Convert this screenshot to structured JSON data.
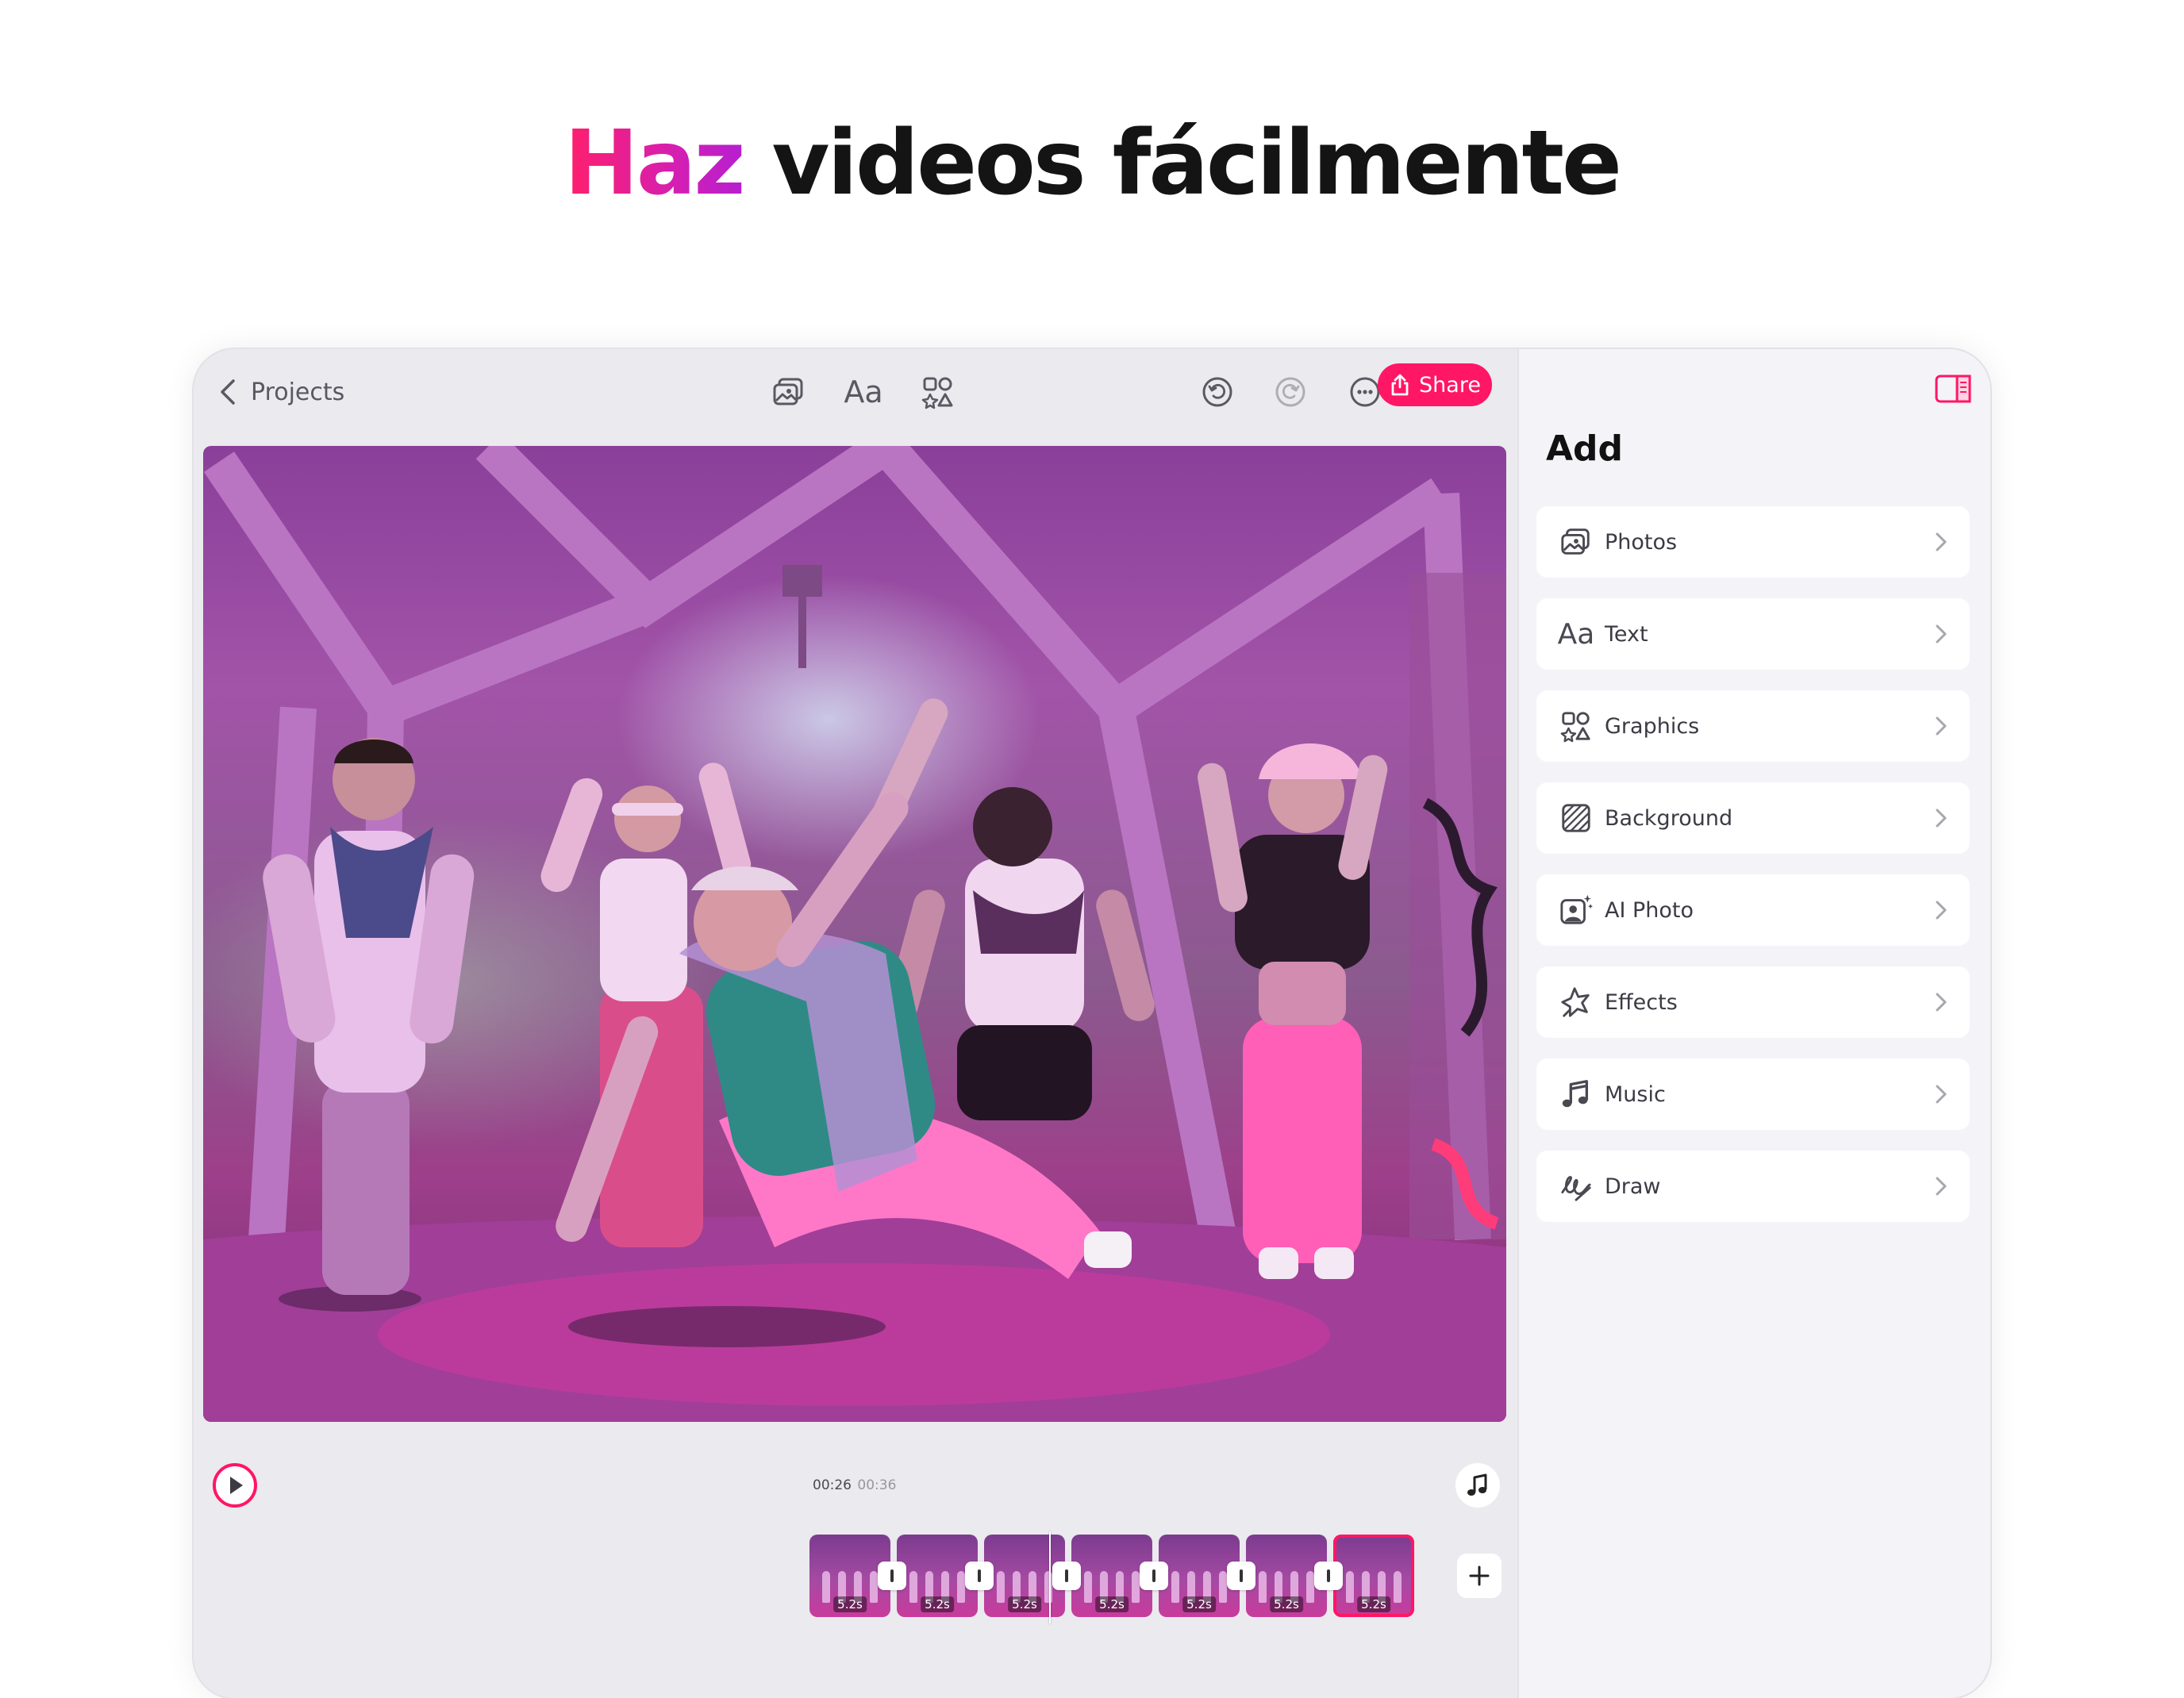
{
  "headline": {
    "accent": "Haz",
    "rest": " videos fácilmente"
  },
  "toolbar": {
    "back_label": "Projects",
    "share_label": "Share",
    "text_tool_label": "Aa"
  },
  "player": {
    "current_time": "00:26",
    "total_time": "00:36"
  },
  "timeline": {
    "clips": [
      {
        "duration": "5.2s",
        "selected": false
      },
      {
        "duration": "5.2s",
        "selected": false
      },
      {
        "duration": "5.2s",
        "selected": false
      },
      {
        "duration": "5.2s",
        "selected": false
      },
      {
        "duration": "5.2s",
        "selected": false
      },
      {
        "duration": "5.2s",
        "selected": false
      },
      {
        "duration": "5.2s",
        "selected": true
      }
    ]
  },
  "panel": {
    "title": "Add",
    "items": [
      {
        "label": "Photos",
        "icon": "photos-icon"
      },
      {
        "label": "Text",
        "icon": "text-aa-icon",
        "icon_text": "Aa"
      },
      {
        "label": "Graphics",
        "icon": "graphics-icon"
      },
      {
        "label": "Background",
        "icon": "background-icon"
      },
      {
        "label": "AI Photo",
        "icon": "ai-photo-icon"
      },
      {
        "label": "Effects",
        "icon": "effects-icon"
      },
      {
        "label": "Music",
        "icon": "music-icon"
      },
      {
        "label": "Draw",
        "icon": "draw-icon"
      }
    ]
  },
  "colors": {
    "accent": "#ff1664",
    "gradient_start": "#ff1f6b",
    "gradient_end": "#b51fd1",
    "device_bg": "#ebeaee",
    "panel_bg": "#f4f3f7"
  }
}
